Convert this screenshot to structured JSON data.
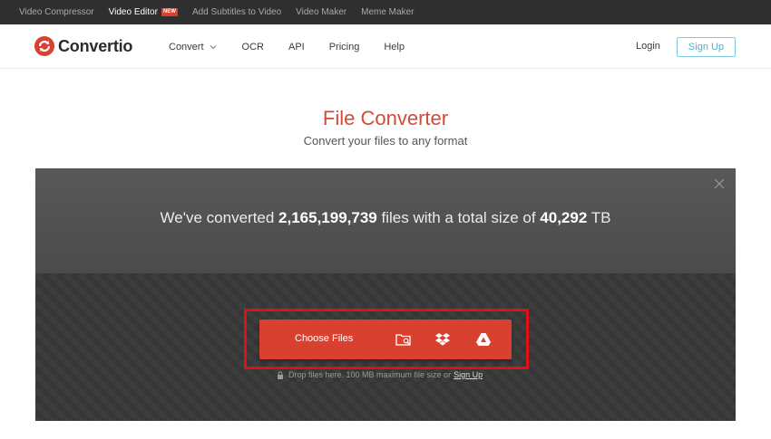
{
  "topbar": {
    "links": [
      "Video Compressor",
      "Video Editor",
      "Add Subtitles to Video",
      "Video Maker",
      "Meme Maker"
    ],
    "new_badge": "NEW"
  },
  "header": {
    "logo_text": "Convertio",
    "nav": [
      "Convert",
      "OCR",
      "API",
      "Pricing",
      "Help"
    ],
    "login": "Login",
    "signup": "Sign Up"
  },
  "hero": {
    "title": "File Converter",
    "subtitle": "Convert your files to any format"
  },
  "stats": {
    "prefix": "We've converted ",
    "files_count": "2,165,199,739",
    "middle": " files with a total size of ",
    "total_size": "40,292",
    "unit": " TB"
  },
  "upload": {
    "choose_label": "Choose Files",
    "sources": [
      "folder-search-icon",
      "dropbox-icon",
      "google-drive-icon"
    ],
    "note_prefix": "Drop files here. 100 MB maximum file size or",
    "note_link": "Sign Up"
  },
  "colors": {
    "brand_red": "#d9402f",
    "highlight_red": "#e0101a",
    "signup_teal": "#4fb0c6"
  }
}
